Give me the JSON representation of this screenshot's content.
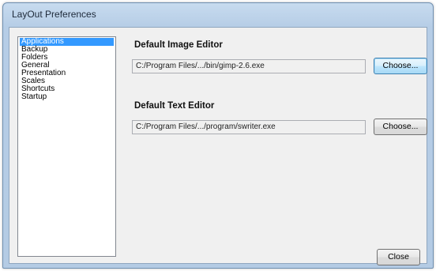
{
  "window": {
    "title": "LayOut Preferences"
  },
  "sidebar": {
    "items": [
      {
        "label": "Applications",
        "selected": true
      },
      {
        "label": "Backup",
        "selected": false
      },
      {
        "label": "Folders",
        "selected": false
      },
      {
        "label": "General",
        "selected": false
      },
      {
        "label": "Presentation",
        "selected": false
      },
      {
        "label": "Scales",
        "selected": false
      },
      {
        "label": "Shortcuts",
        "selected": false
      },
      {
        "label": "Startup",
        "selected": false
      }
    ]
  },
  "image_editor": {
    "title": "Default Image Editor",
    "path": "C:/Program Files/.../bin/gimp-2.6.exe",
    "button_label": "Choose..."
  },
  "text_editor": {
    "title": "Default Text Editor",
    "path": "C:/Program Files/.../program/swriter.exe",
    "button_label": "Choose..."
  },
  "footer": {
    "close_label": "Close"
  },
  "colors": {
    "selection": "#3399ff",
    "title_bar": "#c7dbef"
  }
}
